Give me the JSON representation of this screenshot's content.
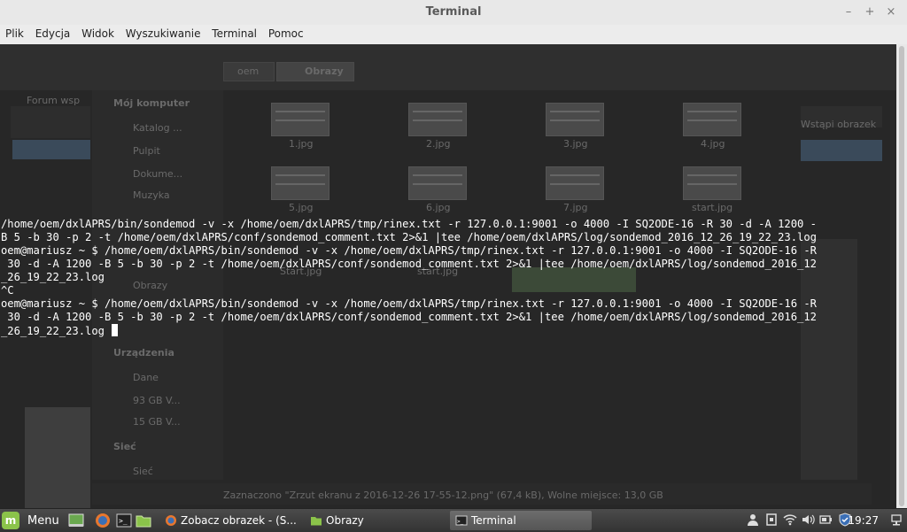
{
  "window": {
    "title": "Terminal",
    "buttons": [
      "–",
      "+",
      "×"
    ]
  },
  "menubar": [
    "Plik",
    "Edycja",
    "Widok",
    "Wyszukiwanie",
    "Terminal",
    "Pomoc"
  ],
  "terminal": {
    "lines": [
      "/home/oem/dxlAPRS/bin/sondemod -v -x /home/oem/dxlAPRS/tmp/rinex.txt -r 127.0.0.1:9001 -o 4000 -I SQ2ODE-16 -R 30 -d -A 1200 -",
      "B 5 -b 30 -p 2 -t /home/oem/dxlAPRS/conf/sondemod_comment.txt 2>&1 |tee /home/oem/dxlAPRS/log/sondemod_2016_12_26_19_22_23.log",
      "oem@mariusz ~ $ /home/oem/dxlAPRS/bin/sondemod -v -x /home/oem/dxlAPRS/tmp/rinex.txt -r 127.0.0.1:9001 -o 4000 -I SQ2ODE-16 -R",
      " 30 -d -A 1200 -B 5 -b 30 -p 2 -t /home/oem/dxlAPRS/conf/sondemod_comment.txt 2>&1 |tee /home/oem/dxlAPRS/log/sondemod_2016_12",
      "_26_19_22_23.log",
      "^C",
      "oem@mariusz ~ $ /home/oem/dxlAPRS/bin/sondemod -v -x /home/oem/dxlAPRS/tmp/rinex.txt -r 127.0.0.1:9001 -o 4000 -I SQ2ODE-16 -R",
      " 30 -d -A 1200 -B 5 -b 30 -p 2 -t /home/oem/dxlAPRS/conf/sondemod_comment.txt 2>&1 |tee /home/oem/dxlAPRS/log/sondemod_2016_12",
      "_26_19_22_23.log "
    ]
  },
  "background_window": {
    "path_home": "oem",
    "path_current": "Obrazy",
    "sidebar_heading": "Mój komputer",
    "sidebar_items": [
      "Katalog ...",
      "Pulpit",
      "Dokume...",
      "Muzyka",
      "Obrazy"
    ],
    "devices_heading": "Urządzenia",
    "devices": [
      "Dane",
      "93 GB V...",
      "15 GB V..."
    ],
    "network_heading": "Sieć",
    "network_item": "Sieć",
    "files_row1": [
      "1.jpg",
      "2.jpg",
      "3.jpg",
      "4.jpg"
    ],
    "files_row2": [
      "5.jpg",
      "6.jpg",
      "7.jpg",
      "start.jpg"
    ],
    "files_row3": [
      "Start.jpg",
      "start.jpg"
    ],
    "statusbar": "Zaznaczono \"Zrzut ekranu z 2016-12-26 17-55-12.png\" (67,4 kB), Wolne miejsce: 13,0 GB",
    "left_text": "Forum wsp",
    "right_text": "Wstąpi obrazek"
  },
  "taskbar": {
    "menu_label": "Menu",
    "tasks": [
      {
        "label": "Zobacz obrazek - (S...",
        "icon": "firefox-icon",
        "active": false
      },
      {
        "label": "Obrazy",
        "icon": "folder-icon",
        "active": false
      },
      {
        "label": "Terminal",
        "icon": "terminal-icon",
        "active": true
      }
    ],
    "clock": "19:27"
  },
  "colors": {
    "terminal_bg": "#272727",
    "terminal_fg": "#ffffff",
    "mint_green": "#8bc34a"
  }
}
